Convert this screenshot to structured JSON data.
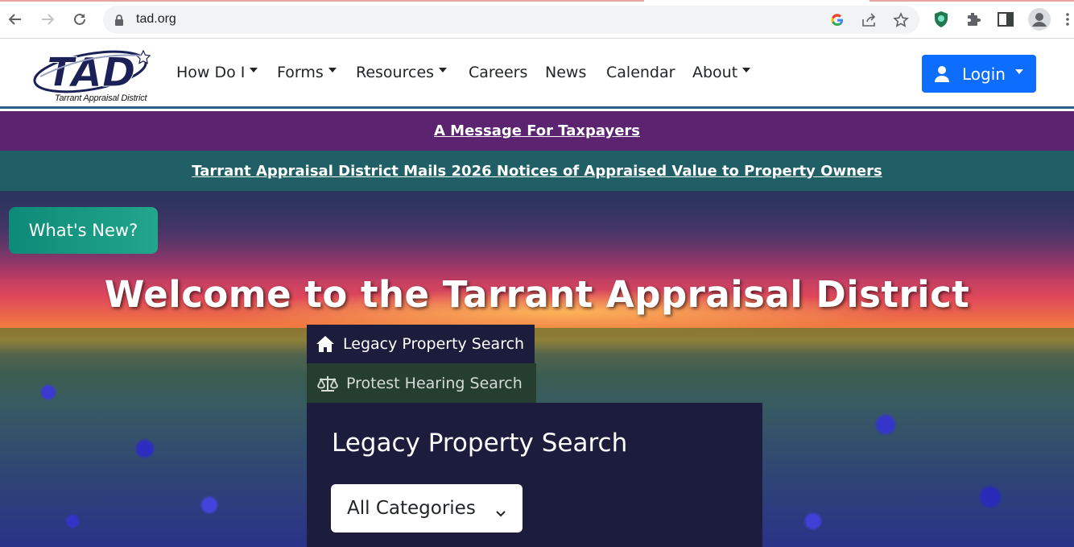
{
  "browser": {
    "url": "tad.org"
  },
  "header": {
    "logo_text": "TAD",
    "logo_tagline": "Tarrant Appraisal District",
    "nav": [
      {
        "label": "How Do I",
        "dropdown": true
      },
      {
        "label": "Forms",
        "dropdown": true
      },
      {
        "label": "Resources",
        "dropdown": true
      },
      {
        "label": "Careers",
        "dropdown": false
      },
      {
        "label": "News",
        "dropdown": false
      },
      {
        "label": "Calendar",
        "dropdown": false
      },
      {
        "label": "About",
        "dropdown": true
      }
    ],
    "login_label": "Login"
  },
  "banners": {
    "message": "A Message For Taxpayers",
    "notice": "Tarrant Appraisal District Mails 2026 Notices of Appraised Value to Property Owners"
  },
  "hero": {
    "whats_new": "What's New?",
    "title": "Welcome to the Tarrant Appraisal District"
  },
  "search": {
    "tabs": [
      {
        "label": "Legacy Property Search",
        "icon": "home-icon",
        "active": true
      },
      {
        "label": "Protest Hearing Search",
        "icon": "scale-icon",
        "active": false
      }
    ],
    "panel_title": "Legacy Property Search",
    "category_selected": "All Categories"
  },
  "colors": {
    "purple_banner": "#5b2370",
    "teal_banner": "#215f67",
    "login_blue": "#0d6efd",
    "panel_navy": "#1c1c3c"
  }
}
